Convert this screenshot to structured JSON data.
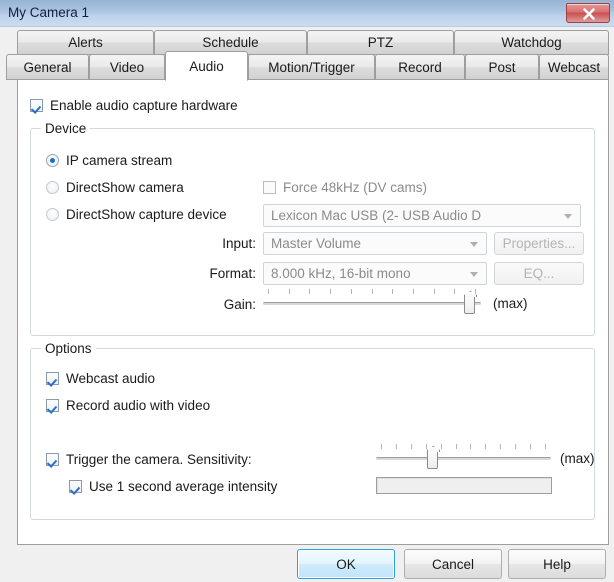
{
  "window": {
    "title": "My Camera 1",
    "close_icon": "close-x-icon"
  },
  "tabs": {
    "row1": [
      {
        "label": "Alerts",
        "active": false
      },
      {
        "label": "Schedule",
        "active": false
      },
      {
        "label": "PTZ",
        "active": false
      },
      {
        "label": "Watchdog",
        "active": false
      }
    ],
    "row2": [
      {
        "label": "General",
        "active": false
      },
      {
        "label": "Video",
        "active": false
      },
      {
        "label": "Audio",
        "active": true
      },
      {
        "label": "Motion/Trigger",
        "active": false
      },
      {
        "label": "Record",
        "active": false
      },
      {
        "label": "Post",
        "active": false
      },
      {
        "label": "Webcast",
        "active": false
      }
    ]
  },
  "audio": {
    "enable_capture": {
      "label": "Enable audio capture hardware",
      "checked": true
    },
    "device_group": {
      "title": "Device",
      "radios": [
        {
          "label": "IP camera stream",
          "selected": true
        },
        {
          "label": "DirectShow camera",
          "selected": false
        },
        {
          "label": "DirectShow capture device",
          "selected": false
        }
      ],
      "force_48khz": {
        "label": "Force 48kHz (DV cams)",
        "checked": false,
        "disabled": true
      },
      "device_combo": {
        "value": "Lexicon Mac USB (2- USB Audio D",
        "disabled": true
      },
      "input_row": {
        "label": "Input:",
        "value": "Master Volume",
        "button": "Properties...",
        "disabled": true
      },
      "format_row": {
        "label": "Format:",
        "value": "8.000 kHz, 16-bit mono",
        "button": "EQ...",
        "disabled": true
      },
      "gain_row": {
        "label": "Gain:",
        "max_label": "(max)",
        "value_percent": 97,
        "tick_count": 11
      }
    },
    "options_group": {
      "title": "Options",
      "webcast_audio": {
        "label": "Webcast audio",
        "checked": true
      },
      "record_audio": {
        "label": "Record audio with video",
        "checked": true
      },
      "trigger": {
        "label": "Trigger the camera. Sensitivity:",
        "checked": true,
        "max_label": "(max)",
        "value_percent": 31,
        "tick_count": 12
      },
      "average_intensity": {
        "label": "Use 1 second average intensity",
        "checked": true,
        "meter_percent": 0
      }
    }
  },
  "footer": {
    "ok": "OK",
    "cancel": "Cancel",
    "help": "Help"
  }
}
